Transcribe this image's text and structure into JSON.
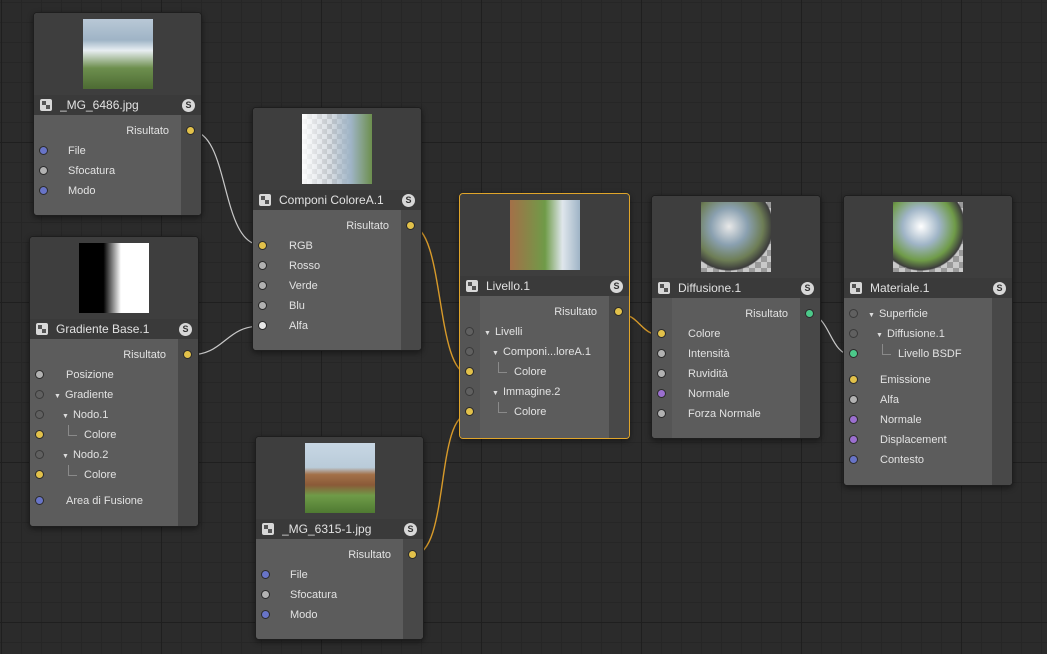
{
  "colors": {
    "background": "#2b2b2b",
    "node": "#5c5c5c",
    "header": "#3a3a3a",
    "selected": "#e0a52a",
    "wire": "#c8c8c8",
    "wire_active": "#d79a2a",
    "yellow_port": "#e2c14a",
    "blue_port": "#6874c7",
    "green_port": "#4cc98a",
    "purple_port": "#9b6fcf"
  },
  "node_mg6486": {
    "title": "_MG_6486.jpg",
    "icon": "node-icon",
    "solo": "S",
    "output": "Risultato",
    "inputs": [
      "File",
      "Sfocatura",
      "Modo"
    ]
  },
  "node_gradient": {
    "title": "Gradiente Base.1",
    "icon": "node-icon",
    "solo": "S",
    "output": "Risultato",
    "inputs": [
      "Posizione",
      "Gradiente",
      "Nodo.1",
      "Colore",
      "Nodo.2",
      "Colore",
      "Area di Fusione"
    ]
  },
  "node_componi": {
    "title": "Componi ColoreA.1",
    "icon": "node-icon",
    "solo": "S",
    "output": "Risultato",
    "inputs": [
      "RGB",
      "Rosso",
      "Verde",
      "Blu",
      "Alfa"
    ]
  },
  "node_mg6315": {
    "title": "_MG_6315-1.jpg",
    "icon": "node-icon",
    "solo": "S",
    "output": "Risultato",
    "inputs": [
      "File",
      "Sfocatura",
      "Modo"
    ]
  },
  "node_livello": {
    "title": "Livello.1",
    "icon": "node-icon",
    "solo": "S",
    "output": "Risultato",
    "inputs": [
      "Livelli",
      "Componi...loreA.1",
      "Colore",
      "Immagine.2",
      "Colore"
    ]
  },
  "node_diffusione": {
    "title": "Diffusione.1",
    "icon": "node-icon",
    "solo": "S",
    "output": "Risultato",
    "inputs": [
      "Colore",
      "Intensità",
      "Ruvidità",
      "Normale",
      "Forza Normale"
    ]
  },
  "node_materiale": {
    "title": "Materiale.1",
    "icon": "node-icon",
    "solo": "S",
    "inputs": [
      "Superficie",
      "Diffusione.1",
      "Livello BSDF",
      "Emissione",
      "Alfa",
      "Normale",
      "Displacement",
      "Contesto"
    ]
  }
}
